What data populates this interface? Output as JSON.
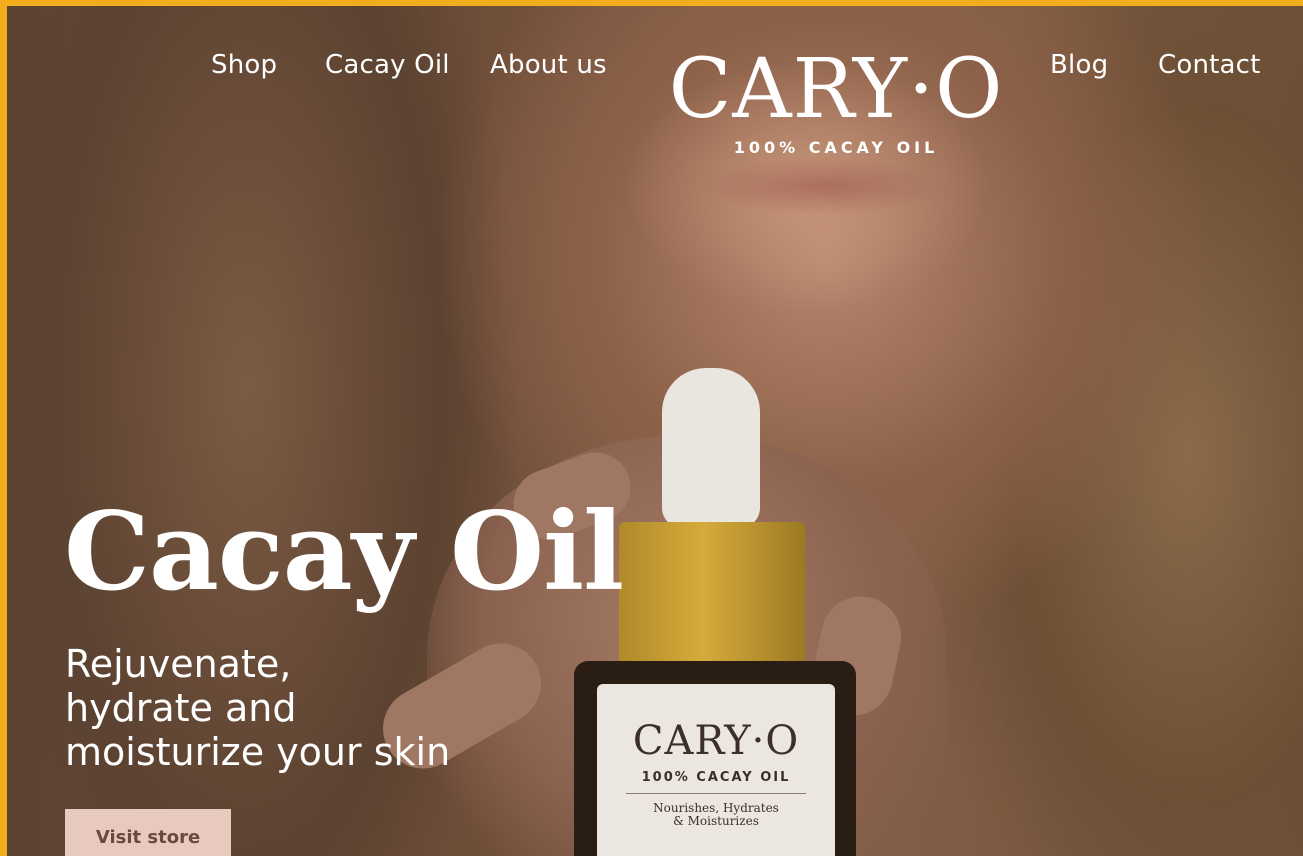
{
  "nav": {
    "items": [
      {
        "label": "Shop"
      },
      {
        "label": "Cacay Oil"
      },
      {
        "label": "About us"
      },
      {
        "label": "Blog"
      },
      {
        "label": "Contact"
      }
    ]
  },
  "logo": {
    "brand": "CARY·O",
    "tagline": "100% CACAY OIL"
  },
  "hero": {
    "title": "Cacay Oil",
    "subtitle_lines": [
      "Rejuvenate,",
      "hydrate and",
      "moisturize your skin"
    ],
    "cta_label": "Visit store"
  },
  "product_label": {
    "brand": "CARY·O",
    "tagline": "100% CACAY OIL",
    "description_lines": [
      "Nourishes, Hydrates",
      "& Moisturizes"
    ]
  },
  "colors": {
    "frame_border": "#f2ad1c",
    "cta_background": "#e8c9be",
    "text": "#ffffff"
  }
}
